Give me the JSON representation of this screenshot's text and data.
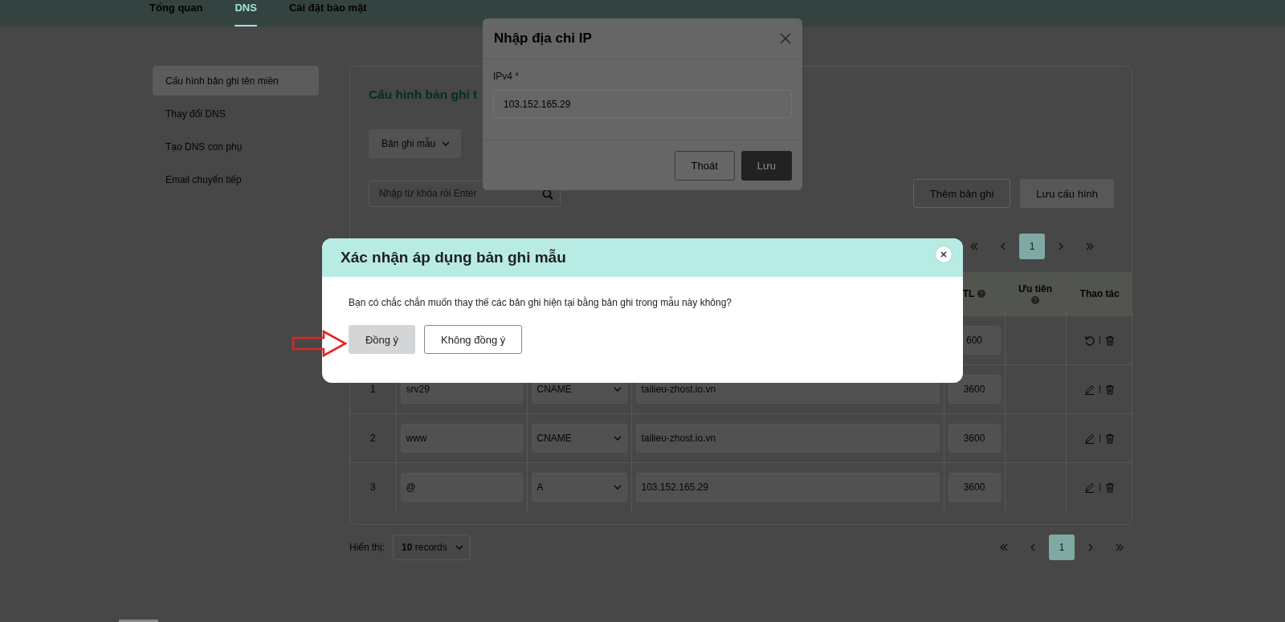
{
  "top_nav": {
    "tabs": [
      {
        "label": "Tổng quan",
        "selected": false
      },
      {
        "label": "DNS",
        "selected": true
      },
      {
        "label": "Cài đặt bảo mật",
        "selected": false
      }
    ]
  },
  "sidebar": {
    "items": [
      {
        "label": "Cấu hình bản ghi tên miền",
        "selected": true
      },
      {
        "label": "Thay đổi DNS",
        "selected": false
      },
      {
        "label": "Tạo DNS con phụ",
        "selected": false
      },
      {
        "label": "Email chuyển tiếp",
        "selected": false
      }
    ]
  },
  "main": {
    "title": "Cấu hình bản ghi t",
    "template_dropdown": "Bản ghi mẫu",
    "search": {
      "placeholder": "Nhập từ khóa rồi Enter"
    },
    "buttons": [
      {
        "label": "Thêm bản ghi",
        "kind": "outline"
      },
      {
        "label": "Lưu cấu hình",
        "kind": "filled"
      }
    ],
    "pagination_top": {
      "pages": [
        {
          "label": "1",
          "selected": true
        }
      ]
    },
    "table": {
      "columns": [
        {
          "label": "TL",
          "help": true
        },
        {
          "label": "Ưu tiên",
          "help": true
        },
        {
          "label": "Thao tác",
          "help": false
        }
      ],
      "rows": [
        {
          "kind": "pending",
          "ttl": "600"
        },
        {
          "kind": "saved",
          "index": "1",
          "name": "srv29",
          "type": "CNAME",
          "value": "tailieu-zhost.io.vn",
          "ttl": "3600"
        },
        {
          "kind": "saved",
          "index": "2",
          "name": "www",
          "type": "CNAME",
          "value": "tailieu-zhost.io.vn",
          "ttl": "3600"
        },
        {
          "kind": "saved",
          "index": "3",
          "name": "@",
          "type": "A",
          "value": "103.152.165.29",
          "ttl": "3600"
        }
      ]
    }
  },
  "footer": {
    "label": "Hiển thị:",
    "page_size": {
      "count": "10",
      "unit": "records"
    },
    "pagination": {
      "pages": [
        {
          "label": "1",
          "selected": true
        }
      ]
    }
  },
  "ip_dialog": {
    "title": "Nhập địa chỉ IP",
    "field_label": "IPv4 *",
    "value": "103.152.165.29",
    "buttons": [
      {
        "label": "Thoát",
        "kind": "outline"
      },
      {
        "label": "Lưu",
        "kind": "filled"
      }
    ]
  },
  "confirm_dialog": {
    "title": "Xác nhận áp dụng bản ghi mẫu",
    "message": "Bạn có chắc chắn muốn thay thế các bản ghi hiện tại bằng bản ghi trong mẫu này không?",
    "buttons": [
      {
        "label": "Đồng ý",
        "kind": "filled"
      },
      {
        "label": "Không đồng ý",
        "kind": "outline"
      }
    ]
  }
}
